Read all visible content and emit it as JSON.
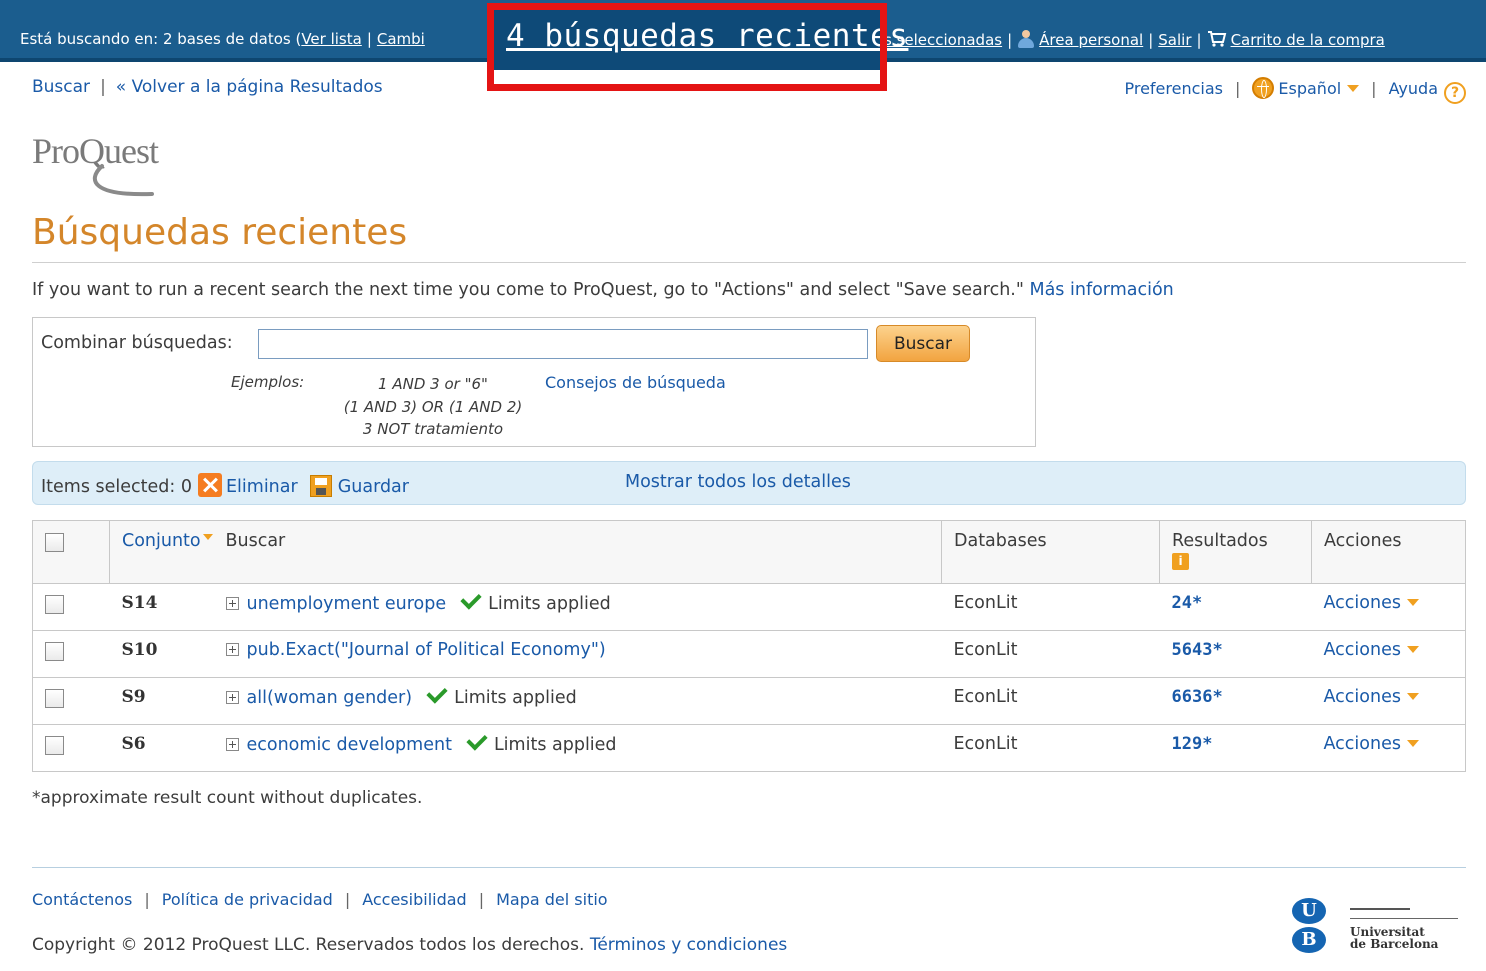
{
  "topbar": {
    "prefix": "Está buscando en: 2 bases de datos (",
    "ver_lista": "Ver lista",
    "sep": "|",
    "cambiar": "Cambi",
    "seleccionadas": "s seleccionadas",
    "area_personal": "Área personal",
    "salir": "Salir",
    "carrito": "Carrito de la compra",
    "recent_searches_link": "4 búsquedas recientes"
  },
  "subnav": {
    "buscar": "Buscar",
    "sep": "|",
    "volver": "« Volver a la página Resultados",
    "preferencias": "Preferencias",
    "idioma": "Español",
    "ayuda": "Ayuda",
    "help_glyph": "?"
  },
  "logo": {
    "text": "ProQuest"
  },
  "page": {
    "title": "Búsquedas recientes",
    "info": "If you want to run a recent search the next time you come to ProQuest, go to \"Actions\" and select \"Save search.\"",
    "mas_info": "Más información"
  },
  "combine": {
    "label": "Combinar búsquedas:",
    "input_value": "",
    "button": "Buscar",
    "examples_label": "Ejemplos:",
    "examples": [
      "1 AND 3 or \"6\"",
      "(1 AND 3) OR (1 AND 2)",
      "3 NOT tratamiento"
    ],
    "tips_link": "Consejos de búsqueda"
  },
  "selection": {
    "items_selected": "Items selected: 0",
    "delete": "Eliminar",
    "save": "Guardar",
    "show_all": "Mostrar todos los detalles"
  },
  "table": {
    "headers": {
      "set": "Conjunto",
      "search": "Buscar",
      "databases": "Databases",
      "results": "Resultados",
      "actions": "Acciones",
      "info_glyph": "i"
    },
    "rows": [
      {
        "set": "S14",
        "query": "unemployment europe",
        "limits": "Limits applied",
        "database": "EconLit",
        "results": "24*",
        "action": "Acciones"
      },
      {
        "set": "S10",
        "query": "pub.Exact(\"Journal of Political Economy\")",
        "limits": "",
        "database": "EconLit",
        "results": "5643*",
        "action": "Acciones"
      },
      {
        "set": "S9",
        "query": "all(woman gender)",
        "limits": "Limits applied",
        "database": "EconLit",
        "results": "6636*",
        "action": "Acciones"
      },
      {
        "set": "S6",
        "query": "economic development",
        "limits": "Limits applied",
        "database": "EconLit",
        "results": "129*",
        "action": "Acciones"
      }
    ]
  },
  "footnote": "*approximate result count without duplicates.",
  "footer": {
    "links": [
      "Contáctenos",
      "Política de privacidad",
      "Accesibilidad",
      "Mapa del sitio"
    ],
    "sep": "|",
    "copyright": "Copyright © 2012 ProQuest LLC. Reservados todos los derechos.",
    "terms": "Términos y condiciones",
    "ub": {
      "u": "U",
      "b": "B",
      "line1": "Universitat",
      "line2": "de Barcelona"
    }
  }
}
